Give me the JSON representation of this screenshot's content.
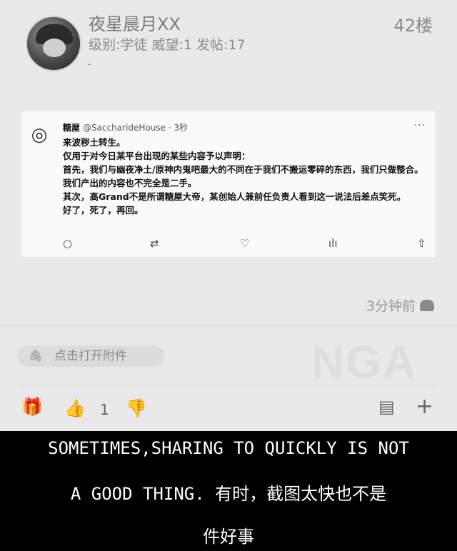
{
  "post": {
    "username": "夜星晨月XX",
    "meta": "级别:学徒 威望:1 发帖:17",
    "dash": "-",
    "floor": "42楼",
    "time": "3分钟前",
    "device_icon": "android-icon"
  },
  "tweet": {
    "name": "糖屋",
    "handle_time": "@SaccharideHouse · 3秒",
    "more": "···",
    "lines": [
      "来波秽土转生。",
      "仅用于对今日某平台出现的某些内容予以声明：",
      "首先，我们与幽夜净土/原神内鬼吧最大的不同在于我们不搬运零碎的东西，我们只做整合。我们产出的内容也不完全是二手。",
      "其次，高Grand不是所谓糖屋大帝，某创始人兼前任负责人看到这一说法后差点笑死。",
      "好了，死了，再回。"
    ]
  },
  "attachment": {
    "label": "点击打开附件"
  },
  "actions": {
    "like_count": "1"
  },
  "watermark": "NGA",
  "caption": {
    "line1": "SOMETIMES,SHARING TO QUICKLY IS NOT",
    "line2": "A GOOD THING. 有时，截图太快也不是",
    "line3": "件好事"
  }
}
